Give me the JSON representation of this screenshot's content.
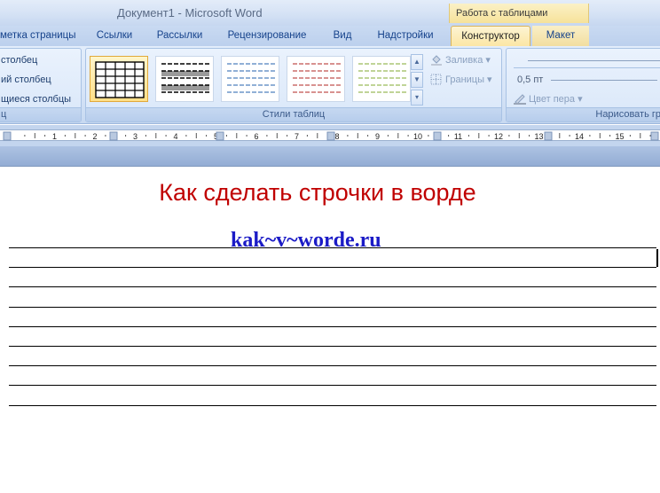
{
  "window": {
    "title": "Документ1 - Microsoft Word",
    "context_group": "Работа с таблицами"
  },
  "tabs": [
    {
      "label": "метка страницы"
    },
    {
      "label": "Ссылки"
    },
    {
      "label": "Рассылки"
    },
    {
      "label": "Рецензирование"
    },
    {
      "label": "Вид"
    },
    {
      "label": "Надстройки"
    },
    {
      "label": "Конструктор",
      "active": true
    },
    {
      "label": "Макет"
    }
  ],
  "ribbon": {
    "options_group": {
      "items": [
        "столбец",
        "ий столбец",
        "щиеся столбцы"
      ],
      "label": "ц"
    },
    "styles_group": {
      "label": "Стили таблиц",
      "fill_label": "Заливка",
      "borders_label": "Границы",
      "styles": [
        {
          "name": "grid",
          "color": "#000000"
        },
        {
          "name": "shaded",
          "color": "#000000"
        },
        {
          "name": "blue",
          "color": "#4f81bd"
        },
        {
          "name": "red",
          "color": "#c0504d"
        },
        {
          "name": "green",
          "color": "#9bbb59"
        }
      ]
    },
    "draw_group": {
      "label": "Нарисовать гр",
      "pen_weight": "0,5 пт",
      "pen_color_label": "Цвет пера"
    }
  },
  "ruler": {
    "numbers": [
      "1",
      "2",
      "3",
      "4",
      "5",
      "6",
      "7",
      "8",
      "9",
      "10",
      "11",
      "12",
      "13",
      "14",
      "15",
      "1"
    ]
  },
  "document": {
    "heading": "Как сделать строчки в ворде",
    "site": "kak~v~worde.ru",
    "line_count": 9,
    "colors": {
      "heading": "#c00000",
      "site": "#1b1bc6"
    }
  }
}
